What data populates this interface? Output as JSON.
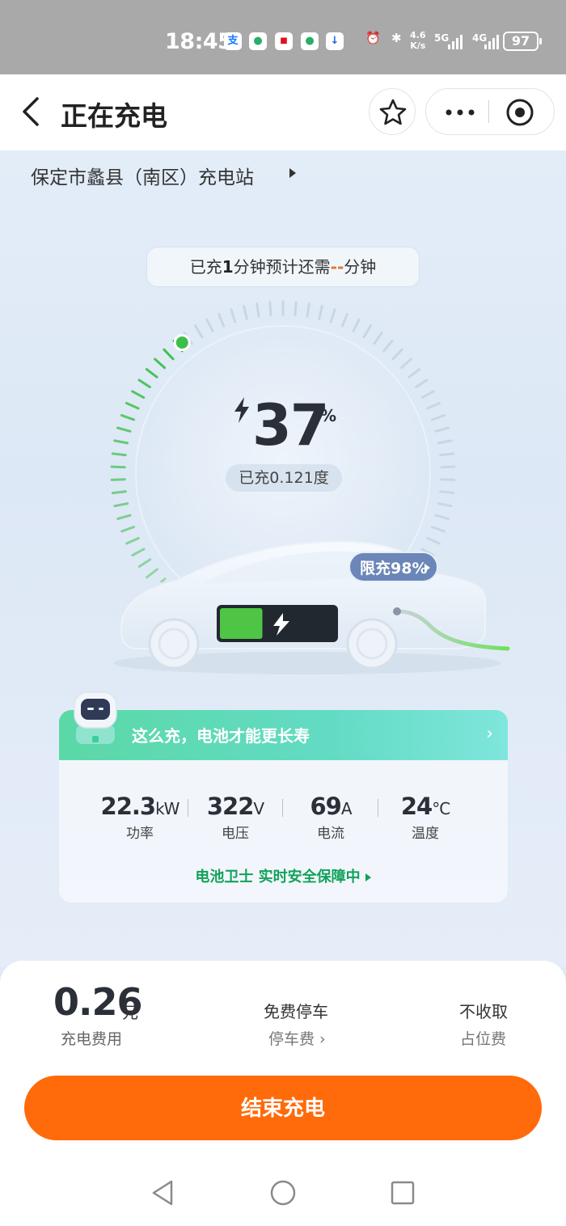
{
  "status_bar": {
    "time": "18:45",
    "net_speed_value": "4.6",
    "net_speed_unit": "K/s",
    "net_5g": "5G",
    "net_4g": "4G",
    "battery": "97",
    "app_icons": [
      "alipay-icon",
      "wechat-icon",
      "headline-icon",
      "wechat-icon",
      "download-icon"
    ],
    "right_icons": [
      "alarm-icon",
      "bluetooth-icon",
      "signal-5g-icon",
      "signal-4g-icon",
      "battery-icon"
    ]
  },
  "nav": {
    "title": "正在充电",
    "back_icon": "chevron-left-icon",
    "favorite_icon": "star-icon",
    "more_icon": "more-icon",
    "close_icon": "target-icon"
  },
  "station": {
    "name": "保定市蠡县（南区）充电站"
  },
  "charging": {
    "elapsed_prefix": "已充",
    "elapsed_minutes": "1",
    "elapsed_mid": "分钟预计还需",
    "remaining_minutes": "--",
    "remaining_suffix": "分钟",
    "percent": "37",
    "percent_sign": "%",
    "percent_value": 0.37,
    "energy_label": "已充0.121度",
    "limit_label": "限充98%",
    "battery_fill": 0.37
  },
  "tips": {
    "headline": "这么充，电池才能更长寿"
  },
  "metrics": [
    {
      "value": "22.3",
      "unit": "kW",
      "label": "功率"
    },
    {
      "value": "322",
      "unit": "V",
      "label": "电压"
    },
    {
      "value": "69",
      "unit": "A",
      "label": "电流"
    },
    {
      "value": "24",
      "unit": "°C",
      "label": "温度"
    }
  ],
  "guard_text": "电池卫士 实时安全保障中",
  "fees": {
    "charge_value": "0.26",
    "charge_unit": "元",
    "charge_label": "充电费用",
    "parking_value": "免费停车",
    "parking_label": "停车费 ›",
    "occupancy_value": "不收取",
    "occupancy_label": "占位费"
  },
  "stop_button": "结束充电",
  "colors": {
    "accent_orange": "#ff6a0a",
    "green": "#12a25b",
    "gauge_green": "#3cbf4a",
    "teal": "#5bd8a6"
  },
  "system_nav": [
    "back-triangle-icon",
    "home-circle-icon",
    "recents-square-icon"
  ]
}
